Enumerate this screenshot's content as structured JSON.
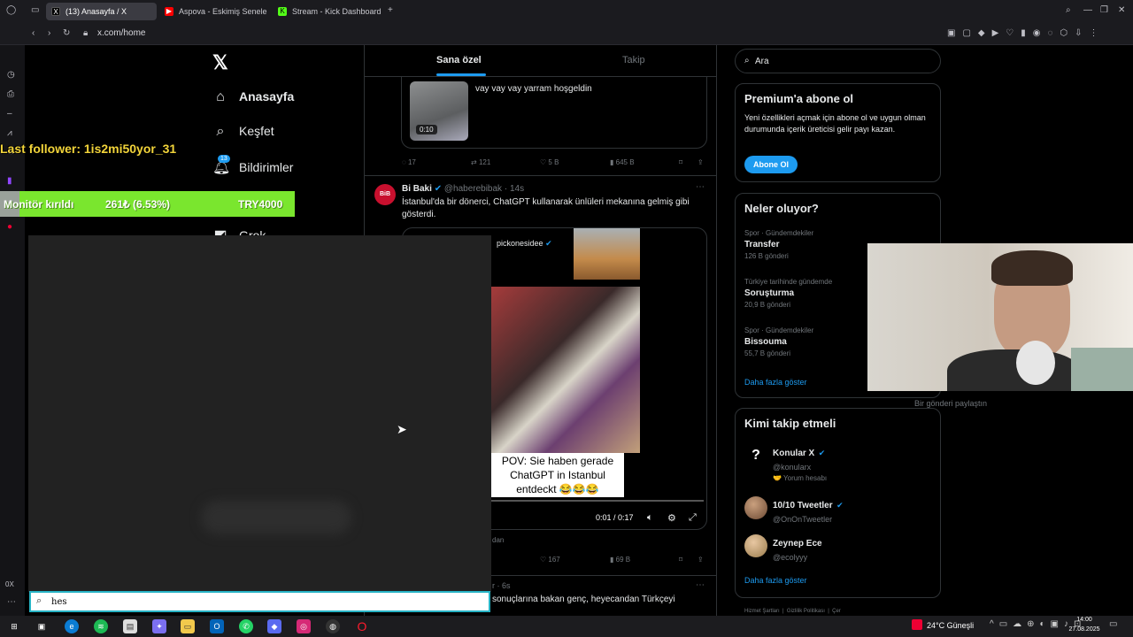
{
  "tabs": [
    {
      "label": "(13) Anasayfa / X",
      "color": "#000000"
    },
    {
      "label": "Aspova - Eskimiş Seneler",
      "color": "#ff0000"
    },
    {
      "label": "Stream - Kick Dashboard",
      "color": "#53fc18"
    }
  ],
  "address": {
    "url": "x.com/home"
  },
  "nav": {
    "home": "Anasayfa",
    "explore": "Keşfet",
    "notifications": "Bildirimler",
    "notif_count": "13",
    "grok": "Grok"
  },
  "timeline": {
    "tab_for_you": "Sana özel",
    "tab_following": "Takip",
    "tweet1": {
      "text": "vay vay vay yarram hoşgeldin",
      "duration": "0:10",
      "replies": "17",
      "retweets": "121",
      "likes": "5 B",
      "views": "645 B"
    },
    "tweet2": {
      "name": "Bi Baki",
      "handle": "@haberebibak · 14s",
      "avatar": "BiB",
      "text": "İstanbul'da bir dönerci, ChatGPT kullanarak ünlüleri mekanına gelmiş gibi gösterdi.",
      "inner_user": "pickonesidee",
      "caption": "POV: Sie haben gerade ChatGPT in Istanbul entdeckt 😂😂😂",
      "time": "0:01 / 0:17",
      "likes": "167",
      "views": "69 B",
      "frag": "dan"
    },
    "tweet3": {
      "handle_frag": "r · 6s",
      "text": "sonuçlarına bakan genç, heyecandan Türkçeyi"
    }
  },
  "search": {
    "placeholder": "Ara"
  },
  "premium": {
    "title": "Premium'a abone ol",
    "text": "Yeni özellikleri açmak için abone ol ve uygun olman durumunda içerik üreticisi gelir payı kazan.",
    "button": "Abone Ol"
  },
  "trends": {
    "title": "Neler oluyor?",
    "items": [
      {
        "context": "Spor · Gündemdekiler",
        "name": "Transfer",
        "count": "126 B gönderi"
      },
      {
        "context": "Türkiye tarihinde gündemde",
        "name": "Soruşturma",
        "count": "20,9 B gönderi"
      },
      {
        "context": "Spor · Gündemdekiler",
        "name": "Bissouma",
        "count": "55,7 B gönderi"
      }
    ],
    "more": "Daha fazla göster"
  },
  "who_to_follow": {
    "title": "Kimi takip etmeli",
    "items": [
      {
        "name": "Konular X",
        "handle": "@konularx",
        "note": "🤝 Yorum hesabı"
      },
      {
        "name": "10/10 Tweetler",
        "handle": "@OnOnTweetler",
        "note": ""
      },
      {
        "name": "Zeynep Ece",
        "handle": "@ecolyyy",
        "note": ""
      }
    ],
    "more": "Daha fazla göster"
  },
  "side_frag": {
    "text": "Bir gönderi paylaştın"
  },
  "footer": {
    "text": "Hizmet Şartları  |  Gizlilik Politikası  |  Çer"
  },
  "overlay": {
    "last_follower": "Last follower: 1is2mi50yor_31",
    "ticker_name": "Monitör kırıldı",
    "ticker_change": "261₺ (6.53%)",
    "ticker_price": "TRY4000"
  },
  "start_search": {
    "value": "hes"
  },
  "taskbar": {
    "weather": "24°C Güneşli",
    "time": "14:00",
    "date": "27.08.2025"
  },
  "colors": {
    "accent": "#1d9bf0",
    "ticker": "#7ae62e",
    "follower": "#f2d43a"
  }
}
